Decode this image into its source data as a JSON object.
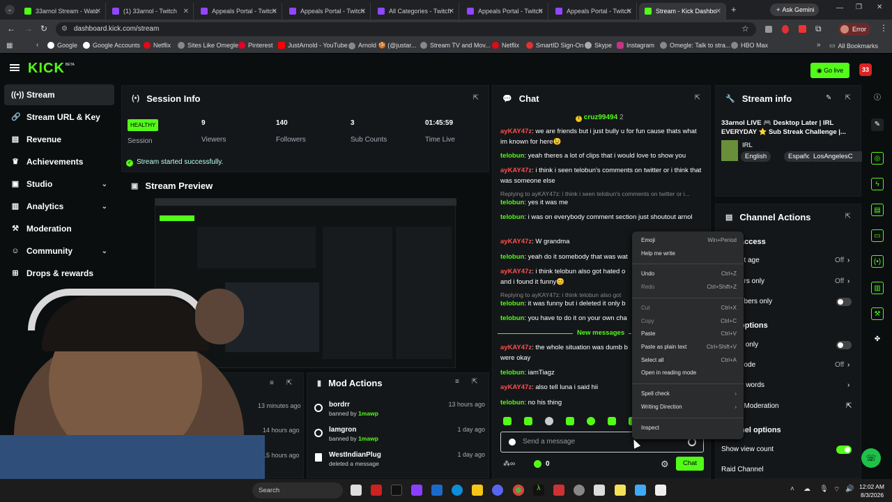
{
  "browser": {
    "tabs": [
      {
        "label": "33arnol Stream - Watc",
        "color": "#53fc18"
      },
      {
        "label": "(1) 33arnol - Twitch",
        "color": "#9146ff"
      },
      {
        "label": "Appeals Portal - Twitch",
        "color": "#9146ff"
      },
      {
        "label": "Appeals Portal - Twitch",
        "color": "#9146ff"
      },
      {
        "label": "All Categories - Twitch",
        "color": "#9146ff"
      },
      {
        "label": "Appeals Portal - Twitch",
        "color": "#9146ff"
      },
      {
        "label": "Appeals Portal - Twitch",
        "color": "#9146ff"
      },
      {
        "label": "Stream - Kick Dashbo",
        "color": "#53fc18"
      }
    ],
    "ask_gemini": "Ask Gemini",
    "profile_status": "Error",
    "url": "dashboard.kick.com/stream",
    "bookmarks": [
      "Google",
      "Google Accounts",
      "Netflix",
      "Sites Like Omegle",
      "Pinterest",
      "JustArnold - YouTube",
      "Arnold 🍪 (@justar...",
      "Stream TV and Mov...",
      "Netflix",
      "SmartID Sign-On",
      "Skype",
      "Instagram",
      "Omegle: Talk to stra...",
      "HBO Max"
    ],
    "all_bookmarks": "All Bookmarks"
  },
  "kick": {
    "logo": "KICK",
    "beta": "BETA",
    "go_live": "Go live",
    "avatar_number": "33",
    "nav": [
      {
        "label": "Stream",
        "icon": "stream-icon"
      },
      {
        "label": "Stream URL & Key",
        "icon": "link-icon"
      },
      {
        "label": "Revenue",
        "icon": "revenue-icon"
      },
      {
        "label": "Achievements",
        "icon": "trophy-icon"
      },
      {
        "label": "Studio",
        "icon": "studio-icon"
      },
      {
        "label": "Analytics",
        "icon": "analytics-icon"
      },
      {
        "label": "Moderation",
        "icon": "hammer-icon"
      },
      {
        "label": "Community",
        "icon": "community-icon"
      },
      {
        "label": "Drops & rewards",
        "icon": "gift-icon"
      }
    ]
  },
  "session": {
    "title": "Session Info",
    "badge": "HEALTHY",
    "badge_label": "Session",
    "stats": [
      {
        "value": "9",
        "label": "Viewers"
      },
      {
        "value": "140",
        "label": "Followers"
      },
      {
        "value": "3",
        "label": "Sub Counts"
      },
      {
        "value": "01:45:59",
        "label": "Time Live"
      }
    ],
    "success": "Stream started successfully."
  },
  "preview": {
    "title": "Stream Preview"
  },
  "mod_actions": {
    "title": "Mod Actions",
    "left_times": [
      "13 minutes ago",
      "14 hours ago",
      "15 hours ago"
    ],
    "items": [
      {
        "name": "bordrr",
        "detail": "banned by",
        "by": "1mawp",
        "time": "13 hours ago"
      },
      {
        "name": "lamgron",
        "detail": "banned by",
        "by": "1mawp",
        "time": "1 day ago"
      },
      {
        "name": "WestIndianPlug",
        "detail": "deleted a message",
        "by": "",
        "time": "1 day ago"
      }
    ]
  },
  "chat": {
    "title": "Chat",
    "pinned_user": "cruz99494",
    "pinned_count": "2",
    "messages": [
      {
        "user": "ayKAY47z",
        "text": "we are friends but i just bully u for fun cause thats what im known for here😉",
        "reply": ""
      },
      {
        "user": "telobun",
        "text": "yeah theres a lot of clips that i would love to show you",
        "reply": ""
      },
      {
        "user": "ayKAY47z",
        "text": "i think i seen telobun's comments on twitter or i think that was someone else",
        "reply": ""
      },
      {
        "user": "telobun",
        "text": "yes it was me",
        "reply": "Replying to ayKAY47z: i think i seen telobun's comments on twitter or i..."
      },
      {
        "user": "telobun",
        "text": "i was on everybody comment section just shoutout arnol",
        "reply": ""
      },
      {
        "user": "ayKAY47z",
        "text": "W grandma",
        "reply": ""
      },
      {
        "user": "telobun",
        "text": "yeah do it somebody that was wat",
        "reply": ""
      },
      {
        "user": "ayKAY47z",
        "text": "i think telobun also got hated o and i found it funny😊",
        "reply": ""
      },
      {
        "user": "telobun",
        "text": "it was funny but i deleted it only b",
        "reply": "Replying to ayKAY47z: i think telobun also got"
      },
      {
        "user": "telobun",
        "text": "you have to do it on your own cha",
        "reply": ""
      },
      {
        "user": "ayKAY47z",
        "text": "the whole situation was dumb b were okay",
        "reply": ""
      },
      {
        "user": "telobun",
        "text": "iamTiagz",
        "reply": ""
      },
      {
        "user": "ayKAY47z",
        "text": "also tell luna i said hii",
        "reply": ""
      },
      {
        "user": "telobun",
        "text": "no his thing",
        "reply": ""
      }
    ],
    "new_messages": "New messages",
    "input_placeholder": "Send a message",
    "count": "0",
    "send": "Chat"
  },
  "context_menu": {
    "items": [
      {
        "label": "Emoji",
        "key": "Win+Period",
        "disabled": false
      },
      {
        "label": "Help me write",
        "key": "",
        "disabled": false
      },
      {
        "label": "Undo",
        "key": "Ctrl+Z",
        "disabled": false
      },
      {
        "label": "Redo",
        "key": "Ctrl+Shift+Z",
        "disabled": true
      },
      {
        "label": "Cut",
        "key": "Ctrl+X",
        "disabled": true
      },
      {
        "label": "Copy",
        "key": "Ctrl+C",
        "disabled": true
      },
      {
        "label": "Paste",
        "key": "Ctrl+V",
        "disabled": false
      },
      {
        "label": "Paste as plain text",
        "key": "Ctrl+Shift+V",
        "disabled": false
      },
      {
        "label": "Select all",
        "key": "Ctrl+A",
        "disabled": false
      },
      {
        "label": "Open in reading mode",
        "key": "",
        "disabled": false
      },
      {
        "label": "Spell check",
        "key": "›",
        "disabled": false
      },
      {
        "label": "Writing Direction",
        "key": "›",
        "disabled": false
      },
      {
        "label": "Inspect",
        "key": "",
        "disabled": false
      }
    ]
  },
  "stream_info": {
    "title": "Stream info",
    "stream_title": "33arnol LIVE 🎮 Desktop Later | IRL EVERYDAY ⭐ Sub Streak Challenge |...",
    "category": "IRL",
    "tags": [
      "English",
      "Español",
      "LosAngelesC"
    ]
  },
  "channel_actions": {
    "title": "Channel Actions",
    "rows": [
      {
        "label": "access",
        "value": "",
        "bold": true
      },
      {
        "label": "nt age",
        "value": "Off"
      },
      {
        "label": "ers only",
        "value": "Off"
      },
      {
        "label": "ribers only",
        "value": ""
      },
      {
        "label": "options",
        "value": "",
        "bold": true
      },
      {
        "label": "s only",
        "value": ""
      },
      {
        "label": "node",
        "value": "Off"
      },
      {
        "label": "d words",
        "value": ""
      },
      {
        "label": "t Moderation",
        "value": ""
      },
      {
        "label": "nel options",
        "value": "",
        "bold": true
      }
    ],
    "show_view_count": "Show view count",
    "raid_channel": "Raid Channel"
  },
  "taskbar": {
    "search": "Search",
    "time": "12:02 AM",
    "date": "8/3/2026"
  }
}
